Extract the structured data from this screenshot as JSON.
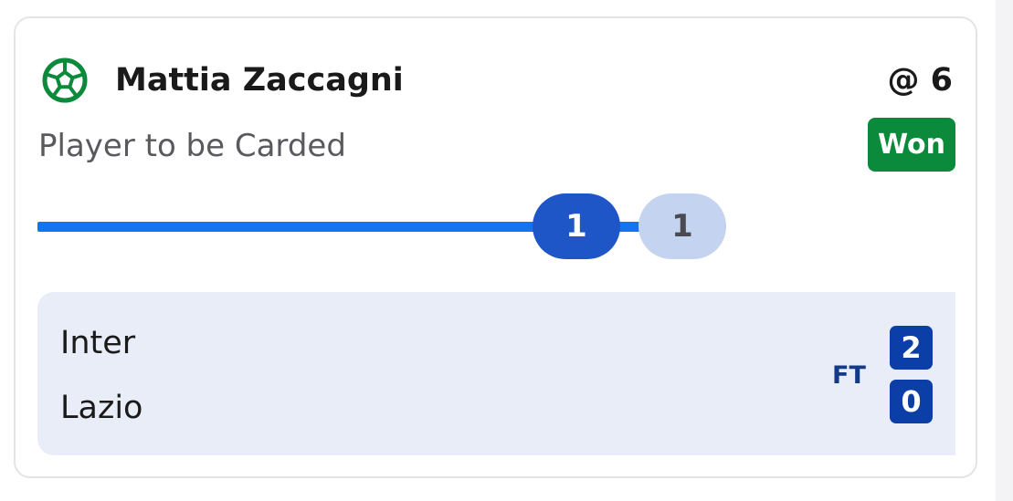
{
  "bet": {
    "icon": "football-icon",
    "player_name": "Mattia Zaccagni",
    "odds": "@ 6",
    "market": "Player to be Carded",
    "status": "Won",
    "status_color": "#0a8a3a"
  },
  "progress": {
    "current": "1",
    "target": "1",
    "fraction": 1.0,
    "bar_color": "#1274f0"
  },
  "match": {
    "home_team": "Inter",
    "away_team": "Lazio",
    "status": "FT",
    "home_score": "2",
    "away_score": "0",
    "score_color": "#0b3ea6"
  }
}
